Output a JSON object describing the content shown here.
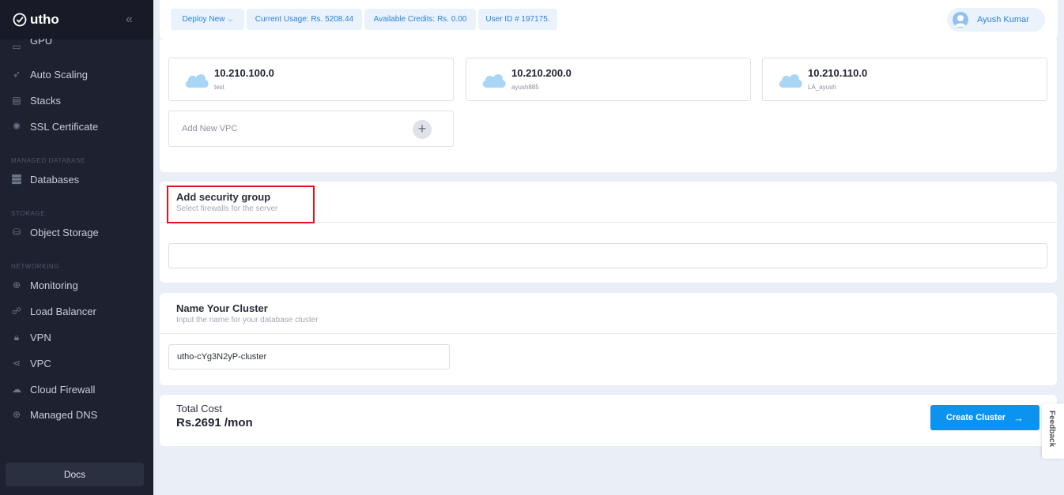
{
  "brand": {
    "name": "utho"
  },
  "sidebar": {
    "items_top": [
      {
        "label": "GPU",
        "icon": "gpu-icon"
      },
      {
        "label": "Auto Scaling",
        "icon": "rocket-icon"
      },
      {
        "label": "Stacks",
        "icon": "stacks-icon"
      },
      {
        "label": "SSL Certificate",
        "icon": "certificate-icon"
      }
    ],
    "sections": {
      "managed_database": "MANAGED DATABASE",
      "storage": "STORAGE",
      "networking": "NETWORKING"
    },
    "databases": "Databases",
    "object_storage": "Object Storage",
    "networking_items": [
      {
        "label": "Monitoring",
        "icon": "globe-icon"
      },
      {
        "label": "Load Balancer",
        "icon": "sitemap-icon"
      },
      {
        "label": "VPN",
        "icon": "lock-icon"
      },
      {
        "label": "VPC",
        "icon": "share-icon"
      },
      {
        "label": "Cloud Firewall",
        "icon": "firewall-icon"
      },
      {
        "label": "Managed DNS",
        "icon": "globe-icon"
      }
    ],
    "docs": "Docs"
  },
  "topbar": {
    "deploy_new": "Deploy New",
    "current_usage": "Current Usage: Rs. 5208.44",
    "available_credits": "Available Credits: Rs. 0.00",
    "user_id": "User ID # 197175.",
    "user_name": "Ayush Kumar"
  },
  "vpc": {
    "tiles": [
      {
        "ip": "10.210.100.0",
        "name": "test"
      },
      {
        "ip": "10.210.200.0",
        "name": "ayush885"
      },
      {
        "ip": "10.210.110.0",
        "name": "LA_ayush"
      }
    ],
    "add_label": "Add New VPC"
  },
  "security_group": {
    "title": "Add security group",
    "subtitle": "Select firewalls for the server",
    "value": ""
  },
  "cluster": {
    "title": "Name Your Cluster",
    "subtitle": "Input the name for your database cluster",
    "value": "utho-cYg3N2yP-cluster"
  },
  "total": {
    "label": "Total Cost",
    "value": "Rs.2691 /mon",
    "button": "Create Cluster"
  },
  "feedback": "Feedback",
  "colors": {
    "accent": "#0b93f0",
    "sidebar": "#1d2130",
    "highlight": "#e0141a"
  }
}
